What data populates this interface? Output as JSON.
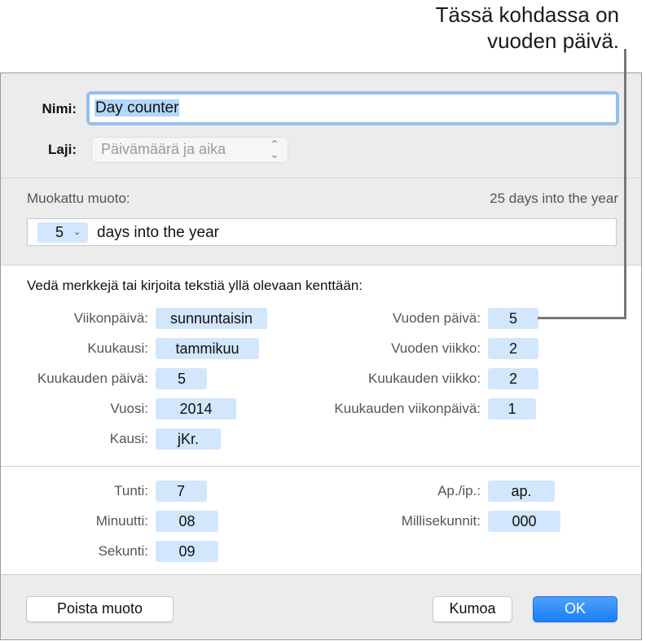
{
  "callout": {
    "line1": "Tässä kohdassa on",
    "line2": "vuoden päivä."
  },
  "name_row": {
    "label": "Nimi:",
    "value": "Day counter"
  },
  "type_row": {
    "label": "Laji:",
    "value": "Päivämäärä ja aika"
  },
  "custom_format": {
    "label": "Muokattu muoto:",
    "preview": "25 days into the year",
    "token_value": "5",
    "suffix_text": "days into the year"
  },
  "instructions": "Vedä merkkejä tai kirjoita tekstiä yllä olevaan kenttään:",
  "date_tokens_left": [
    {
      "label": "Viikonpäivä:",
      "value": "sunnuntaisin"
    },
    {
      "label": "Kuukausi:",
      "value": "tammikuu"
    },
    {
      "label": "Kuukauden päivä:",
      "value": "5"
    },
    {
      "label": "Vuosi:",
      "value": "2014"
    },
    {
      "label": "Kausi:",
      "value": "jKr."
    }
  ],
  "date_tokens_right": [
    {
      "label": "Vuoden päivä:",
      "value": "5"
    },
    {
      "label": "Vuoden viikko:",
      "value": "2"
    },
    {
      "label": "Kuukauden viikko:",
      "value": "2"
    },
    {
      "label": "Kuukauden viikonpäivä:",
      "value": "1"
    }
  ],
  "time_tokens_left": [
    {
      "label": "Tunti:",
      "value": "7"
    },
    {
      "label": "Minuutti:",
      "value": "08"
    },
    {
      "label": "Sekunti:",
      "value": "09"
    }
  ],
  "time_tokens_right": [
    {
      "label": "Ap./ip.:",
      "value": "ap."
    },
    {
      "label": "Millisekunnit:",
      "value": "000"
    }
  ],
  "buttons": {
    "remove_format": "Poista muoto",
    "cancel": "Kumoa",
    "ok": "OK"
  },
  "colors": {
    "accent": "#1a7ff7",
    "token_bg": "#d2e6fc",
    "focus_ring": "#93bfef"
  }
}
